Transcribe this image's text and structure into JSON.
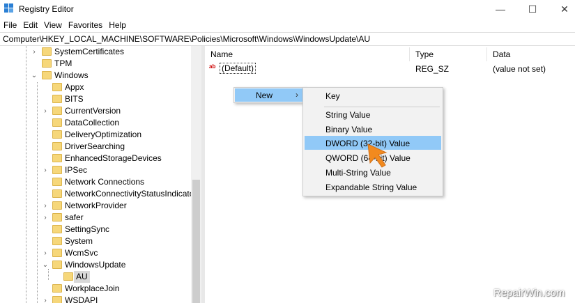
{
  "window": {
    "title": "Registry Editor",
    "minimize": "—",
    "maximize": "☐",
    "close": "✕"
  },
  "menubar": [
    "File",
    "Edit",
    "View",
    "Favorites",
    "Help"
  ],
  "address": "Computer\\HKEY_LOCAL_MACHINE\\SOFTWARE\\Policies\\Microsoft\\Windows\\WindowsUpdate\\AU",
  "tree": [
    {
      "label": "SystemCertificates",
      "expander": "›"
    },
    {
      "label": "TPM",
      "expander": ""
    },
    {
      "label": "Windows",
      "expander": "⌄"
    },
    {
      "label": "Appx",
      "expander": ""
    },
    {
      "label": "BITS",
      "expander": ""
    },
    {
      "label": "CurrentVersion",
      "expander": "›"
    },
    {
      "label": "DataCollection",
      "expander": ""
    },
    {
      "label": "DeliveryOptimization",
      "expander": ""
    },
    {
      "label": "DriverSearching",
      "expander": ""
    },
    {
      "label": "EnhancedStorageDevices",
      "expander": ""
    },
    {
      "label": "IPSec",
      "expander": "›"
    },
    {
      "label": "Network Connections",
      "expander": ""
    },
    {
      "label": "NetworkConnectivityStatusIndicator",
      "expander": ""
    },
    {
      "label": "NetworkProvider",
      "expander": "›"
    },
    {
      "label": "safer",
      "expander": "›"
    },
    {
      "label": "SettingSync",
      "expander": ""
    },
    {
      "label": "System",
      "expander": ""
    },
    {
      "label": "WcmSvc",
      "expander": "›"
    },
    {
      "label": "WindowsUpdate",
      "expander": "⌄"
    },
    {
      "label": "AU",
      "expander": ""
    },
    {
      "label": "WorkplaceJoin",
      "expander": ""
    },
    {
      "label": "WSDAPI",
      "expander": "›"
    }
  ],
  "list": {
    "columns": {
      "name": "Name",
      "type": "Type",
      "data": "Data"
    },
    "rows": [
      {
        "name": "(Default)",
        "type": "REG_SZ",
        "data": "(value not set)",
        "icon": "ab"
      }
    ]
  },
  "context_menu": {
    "new": "New",
    "arrow": "›"
  },
  "submenu": {
    "key": "Key",
    "items": [
      "String Value",
      "Binary Value",
      "DWORD (32-bit) Value",
      "QWORD (64-bit) Value",
      "Multi-String Value",
      "Expandable String Value"
    ]
  },
  "watermark": "RepairWin.com",
  "colors": {
    "highlight": "#91c9f7",
    "pointer": "#f28a1e",
    "folder": "#f6d77a"
  }
}
